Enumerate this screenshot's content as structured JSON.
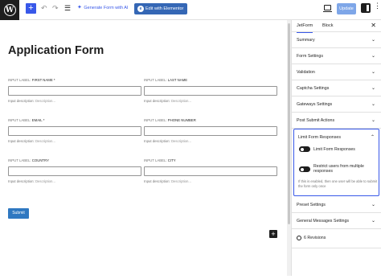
{
  "toolbar": {
    "wp_logo": "W",
    "add_block": "+",
    "undo_icon": "undo-icon",
    "redo_icon": "redo-icon",
    "doc_overview_icon": "list-icon",
    "undo_glyph": "↶",
    "redo_glyph": "↷",
    "list_glyph": "☰",
    "generate_ai": "Generate Form with AI",
    "generate_ai_glyph": "✦",
    "edit_elementor": "Edit with Elementor",
    "elementor_glyph": "e",
    "update": "Update",
    "more_glyph": "⋮"
  },
  "editor": {
    "title": "Application Form",
    "fields": [
      {
        "label_prefix": "INPUT LABEL:",
        "label": "FIRST NAME *",
        "desc_prefix": "Input description:",
        "desc": "Description..."
      },
      {
        "label_prefix": "INPUT LABEL:",
        "label": "LAST NAME",
        "desc_prefix": "Input description:",
        "desc": "Description..."
      },
      {
        "label_prefix": "INPUT LABEL:",
        "label": "EMAIL *",
        "desc_prefix": "Input description:",
        "desc": "Description..."
      },
      {
        "label_prefix": "INPUT LABEL:",
        "label": "PHONE NUMBER",
        "desc_prefix": "Input description:",
        "desc": "Description..."
      },
      {
        "label_prefix": "INPUT LABEL:",
        "label": "COUNTRY",
        "desc_prefix": "Input description:",
        "desc": "Description..."
      },
      {
        "label_prefix": "INPUT LABEL:",
        "label": "CITY",
        "desc_prefix": "Input description:",
        "desc": "Description..."
      }
    ],
    "submit": "Submit",
    "block_inserter": "+"
  },
  "sidebar": {
    "tabs": [
      {
        "label": "JetForm"
      },
      {
        "label": "Block"
      }
    ],
    "close_glyph": "✕",
    "panels": [
      {
        "title": "Summary"
      },
      {
        "title": "Form Settings"
      },
      {
        "title": "Validation"
      },
      {
        "title": "Captcha Settings"
      },
      {
        "title": "Gateways Settings"
      },
      {
        "title": "Post Submit Actions"
      }
    ],
    "limit_panel": {
      "title": "Limit Form Responses",
      "toggle1": "Limit Form Responses",
      "toggle2": "Restrict users from multiple responses",
      "help": "If this is enabled, then one user will be able to submit the form only once"
    },
    "panels_after": [
      {
        "title": "Preset Settings"
      },
      {
        "title": "General Messages Settings"
      }
    ],
    "revisions": "6 Revisions",
    "chevron_down": "⌄",
    "chevron_up": "⌃"
  }
}
